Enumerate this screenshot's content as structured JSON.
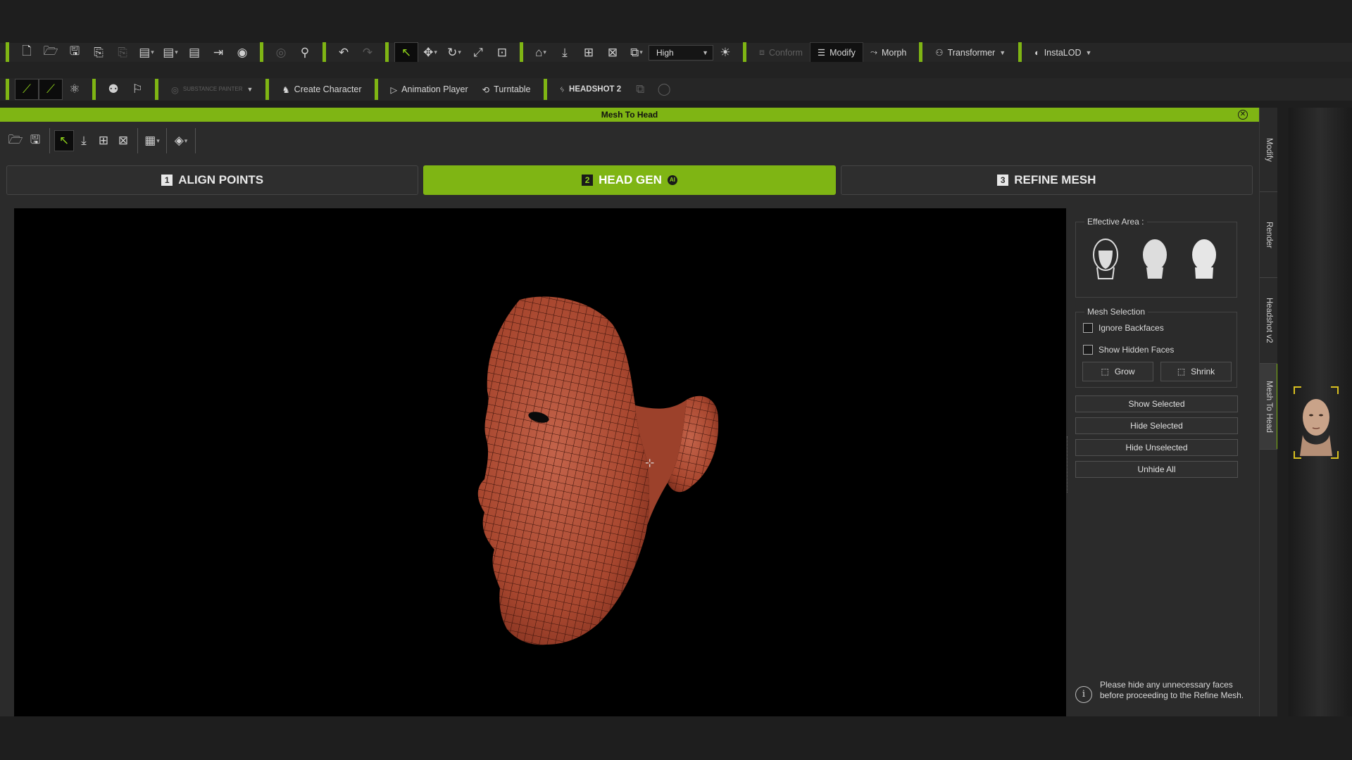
{
  "toolbar1": {
    "quality": "High",
    "conform": "Conform",
    "modify": "Modify",
    "morph": "Morph",
    "transformer": "Transformer",
    "instalod": "InstaLOD"
  },
  "toolbar2": {
    "substance": "SUBSTANCE PAINTER",
    "create_character": "Create Character",
    "animation_player": "Animation Player",
    "turntable": "Turntable",
    "headshot": "HEADSHOT 2"
  },
  "panel": {
    "title": "Mesh To Head",
    "tabs": [
      {
        "num": "1",
        "label": "ALIGN POINTS"
      },
      {
        "num": "2",
        "label": "HEAD GEN",
        "badge": "AI"
      },
      {
        "num": "3",
        "label": "REFINE MESH"
      }
    ],
    "effective_area_label": "Effective Area :",
    "mesh_selection_label": "Mesh Selection",
    "ignore_backfaces": "Ignore Backfaces",
    "show_hidden_faces": "Show Hidden Faces",
    "grow": "Grow",
    "shrink": "Shrink",
    "show_selected": "Show Selected",
    "hide_selected": "Hide Selected",
    "hide_unselected": "Hide Unselected",
    "unhide_all": "Unhide All",
    "info_text": "Please hide any unnecessary faces before proceeding to the Refine Mesh."
  },
  "side_tabs": [
    "Modify",
    "Render",
    "Headshot v2",
    "Mesh To Head"
  ],
  "colors": {
    "accent": "#7fb514",
    "mesh": "#b5533a"
  }
}
